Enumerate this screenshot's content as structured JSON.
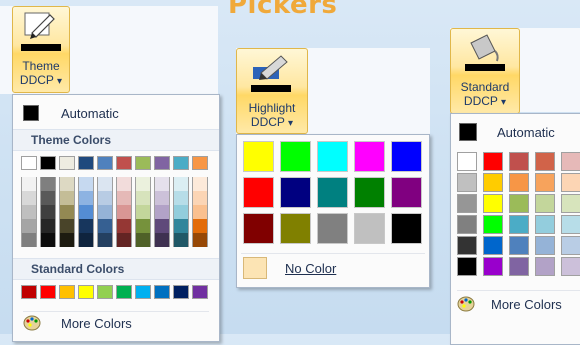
{
  "heading": "Pickers",
  "theme_picker": {
    "button_line1": "Theme",
    "button_line2": "DDCP",
    "dropdown_arrow": "▾",
    "automatic_label": "Automatic",
    "theme_colors_label": "Theme Colors",
    "standard_colors_label": "Standard Colors",
    "more_colors_label": "More Colors",
    "theme_top_row": [
      "#ffffff",
      "#000000",
      "#eeece1",
      "#1f497d",
      "#4f81bd",
      "#c0504d",
      "#9bbb59",
      "#8064a2",
      "#4bacc6",
      "#f79646"
    ],
    "theme_shades": [
      [
        "#f2f2f2",
        "#7f7f7f",
        "#ddd9c3",
        "#c6d9f0",
        "#dbe5f1",
        "#f2dcdb",
        "#ebf1dd",
        "#e5e0ec",
        "#dbeef3",
        "#fdeada"
      ],
      [
        "#d8d8d8",
        "#595959",
        "#c4bd97",
        "#8db3e2",
        "#b8cce4",
        "#e5b9b7",
        "#d7e3bc",
        "#ccc1d9",
        "#b7dde8",
        "#fbd5b5"
      ],
      [
        "#bfbfbf",
        "#3f3f3f",
        "#938953",
        "#548dd4",
        "#95b3d7",
        "#d99694",
        "#c3d69b",
        "#b2a2c7",
        "#92cddc",
        "#fac08f"
      ],
      [
        "#a5a5a5",
        "#262626",
        "#494429",
        "#17365d",
        "#366092",
        "#953734",
        "#76923c",
        "#5f497a",
        "#31859b",
        "#e36c09"
      ],
      [
        "#7f7f7f",
        "#0c0c0c",
        "#1d1b10",
        "#0f243e",
        "#244061",
        "#632423",
        "#4f6128",
        "#3f3151",
        "#205867",
        "#974806"
      ]
    ],
    "standard_colors": [
      "#c00000",
      "#ff0000",
      "#ffc000",
      "#ffff00",
      "#92d050",
      "#00b050",
      "#00b0f0",
      "#0070c0",
      "#002060",
      "#7030a0"
    ]
  },
  "highlight_picker": {
    "button_line1": "Highlight",
    "button_line2": "DDCP",
    "dropdown_arrow": "▾",
    "no_color_label": "No Color",
    "colors": [
      [
        "#ffff00",
        "#00ff00",
        "#00ffff",
        "#ff00ff",
        "#0000ff"
      ],
      [
        "#ff0000",
        "#000080",
        "#008080",
        "#008000",
        "#800080"
      ],
      [
        "#800000",
        "#808000",
        "#808080",
        "#c0c0c0",
        "#000000"
      ]
    ]
  },
  "standard_picker": {
    "button_line1": "Standard",
    "button_line2": "DDCP",
    "dropdown_arrow": "▾",
    "automatic_label": "Automatic",
    "more_colors_label": "More Colors",
    "columns": [
      [
        "#ffffff",
        "#c0c0c0",
        "#969696",
        "#808080",
        "#333333",
        "#000000"
      ],
      [
        "#ff0000",
        "#ffcc00",
        "#ffff00",
        "#00ff00",
        "#0066cc",
        "#9900cc"
      ],
      [
        "#c0504d",
        "#f79646",
        "#9bbb59",
        "#4bacc6",
        "#4f81bd",
        "#8064a2"
      ],
      [
        "#d16349",
        "#f7a35c",
        "#c3d69b",
        "#93cddd",
        "#95b3d7",
        "#b2a2c7"
      ],
      [
        "#e6b9b8",
        "#fcd5b4",
        "#d7e4bc",
        "#b7dde8",
        "#b9cde5",
        "#ccc0da"
      ]
    ]
  }
}
